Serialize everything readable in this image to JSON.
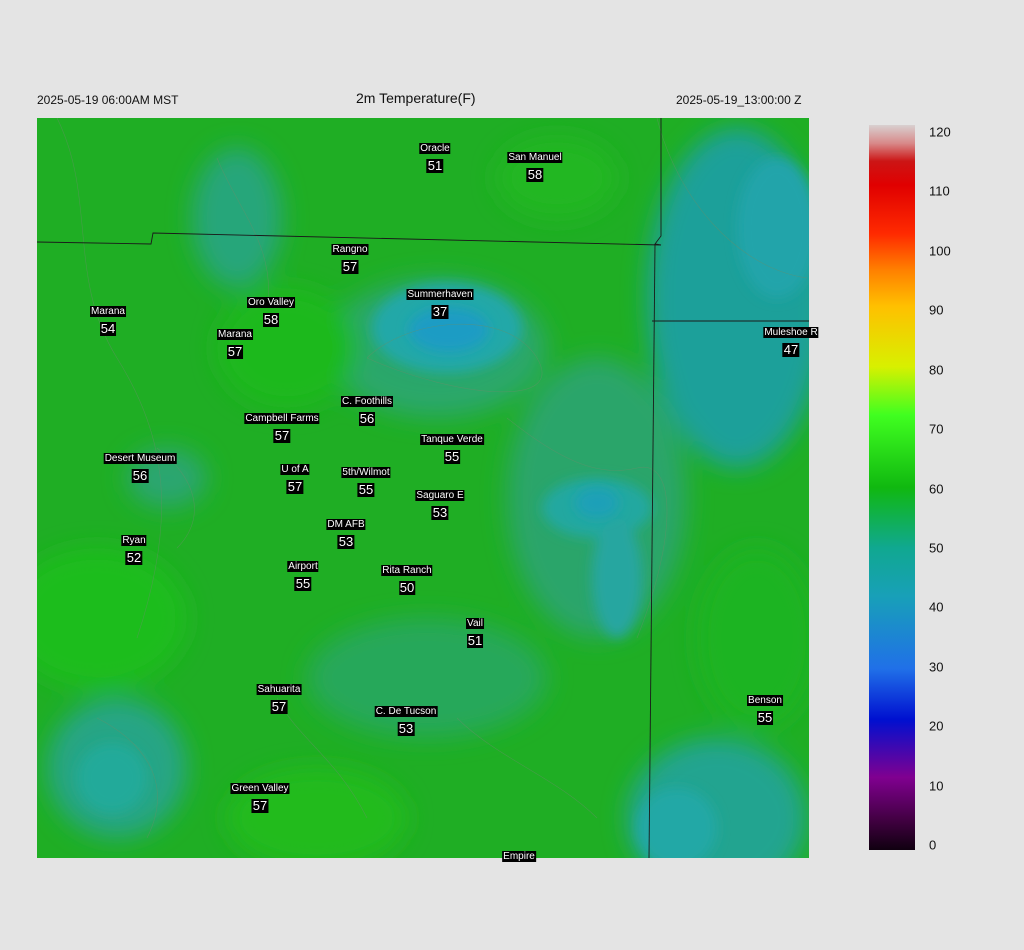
{
  "header": {
    "local_time": "2025-05-19 06:00AM MST",
    "title": "2m Temperature(F)",
    "utc_time": "2025-05-19_13:00:00 Z"
  },
  "colorbar": {
    "ticks": [
      "120",
      "110",
      "100",
      "90",
      "80",
      "70",
      "60",
      "50",
      "40",
      "30",
      "20",
      "10",
      "0"
    ],
    "range": [
      0,
      120
    ]
  },
  "stations": [
    {
      "name": "Oracle",
      "temp": "51"
    },
    {
      "name": "San Manuel",
      "temp": "58"
    },
    {
      "name": "Rangno",
      "temp": "57"
    },
    {
      "name": "Summerhaven",
      "temp": "37"
    },
    {
      "name": "Oro Valley",
      "temp": "58"
    },
    {
      "name": "Marana",
      "temp": "54"
    },
    {
      "name": "Marana",
      "temp": "57"
    },
    {
      "name": "Muleshoe R",
      "temp": "47"
    },
    {
      "name": "C. Foothills",
      "temp": "56"
    },
    {
      "name": "Campbell Farms",
      "temp": "57"
    },
    {
      "name": "Tanque Verde",
      "temp": "55"
    },
    {
      "name": "Desert Museum",
      "temp": "56"
    },
    {
      "name": "U of A",
      "temp": "57"
    },
    {
      "name": "5th/Wilmot",
      "temp": "55"
    },
    {
      "name": "Saguaro E",
      "temp": "53"
    },
    {
      "name": "DM AFB",
      "temp": "53"
    },
    {
      "name": "Ryan",
      "temp": "52"
    },
    {
      "name": "Airport",
      "temp": "55"
    },
    {
      "name": "Rita Ranch",
      "temp": "50"
    },
    {
      "name": "Vail",
      "temp": "51"
    },
    {
      "name": "Sahuarita",
      "temp": "57"
    },
    {
      "name": "C. De Tucson",
      "temp": "53"
    },
    {
      "name": "Benson",
      "temp": "55"
    },
    {
      "name": "Green Valley",
      "temp": "57"
    },
    {
      "name": "Empire",
      "temp": ""
    }
  ]
}
